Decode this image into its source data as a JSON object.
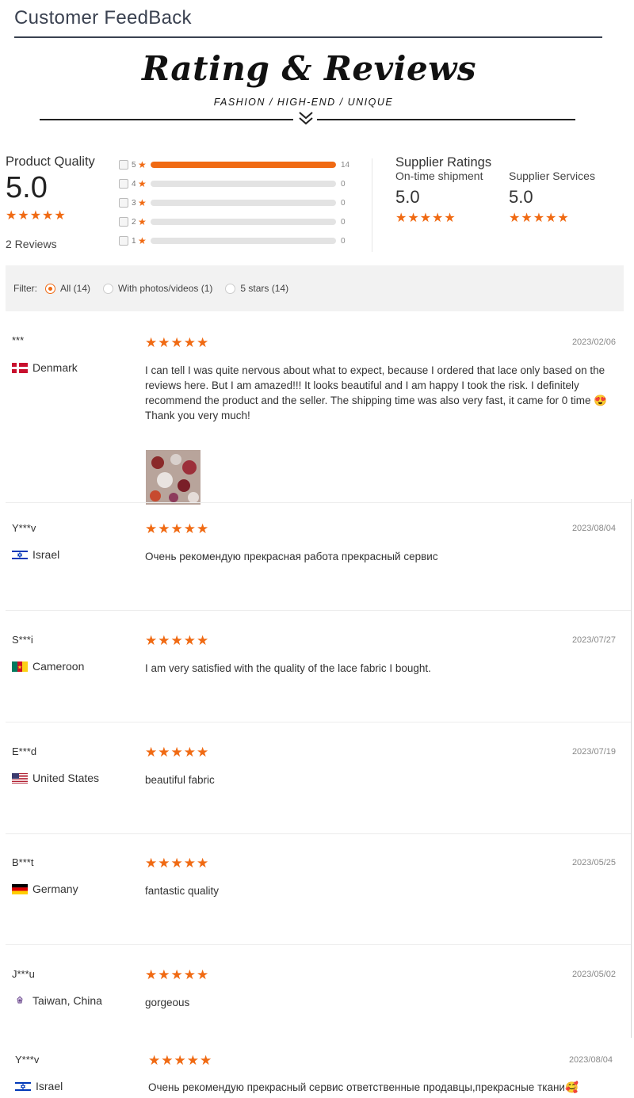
{
  "header": {
    "title": "Customer FeedBack"
  },
  "banner": {
    "title": "Rating & Reviews",
    "subtitle": "FASHION / HIGH-END / UNIQUE"
  },
  "product_quality": {
    "label": "Product Quality",
    "score": "5.0",
    "stars": 5,
    "reviews_label": "2 Reviews",
    "distribution": [
      {
        "stars": "5",
        "count": "14",
        "fraction": 1.0
      },
      {
        "stars": "4",
        "count": "0",
        "fraction": 0
      },
      {
        "stars": "3",
        "count": "0",
        "fraction": 0
      },
      {
        "stars": "2",
        "count": "0",
        "fraction": 0
      },
      {
        "stars": "1",
        "count": "0",
        "fraction": 0
      }
    ]
  },
  "supplier_ratings": {
    "title": "Supplier Ratings",
    "shipment": {
      "label": "On-time shipment",
      "score": "5.0",
      "stars": 5
    },
    "services": {
      "label": "Supplier Services",
      "score": "5.0",
      "stars": 5
    }
  },
  "filter": {
    "label": "Filter:",
    "options": [
      {
        "label": "All (14)",
        "selected": true
      },
      {
        "label": "With photos/videos (1)",
        "selected": false
      },
      {
        "label": "5 stars (14)",
        "selected": false
      }
    ]
  },
  "reviews": [
    {
      "user": "***",
      "country": "Denmark",
      "flag": "denmark-flag-icon",
      "date": "2023/02/06",
      "stars": 5,
      "text": "I can tell I was quite nervous about what to expect, because I ordered that lace only based on the reviews here. But I am amazed!!! It looks beautiful and I am happy I took the risk. I definitely recommend the product and the seller. The shipping time was also very fast, it came for 0 time 😍 Thank you very much!",
      "has_photo": true
    },
    {
      "user": "Y***v",
      "country": "Israel",
      "flag": "israel-flag-icon",
      "date": "2023/08/04",
      "stars": 5,
      "text": "Очень рекомендую прекрасная работа прекрасный сервис"
    },
    {
      "user": "S***i",
      "country": "Cameroon",
      "flag": "cameroon-flag-icon",
      "date": "2023/07/27",
      "stars": 5,
      "text": "I am very satisfied with the quality of the lace fabric I bought."
    },
    {
      "user": "E***d",
      "country": "United States",
      "flag": "usa-flag-icon",
      "date": "2023/07/19",
      "stars": 5,
      "text": "beautiful fabric"
    },
    {
      "user": "B***t",
      "country": "Germany",
      "flag": "germany-flag-icon",
      "date": "2023/05/25",
      "stars": 5,
      "text": "fantastic quality"
    },
    {
      "user": "J***u",
      "country": "Taiwan, China",
      "flag": "taiwan-flag-icon",
      "date": "2023/05/02",
      "stars": 5,
      "text": "gorgeous"
    },
    {
      "user": "Y***v",
      "country": "Israel",
      "flag": "israel-flag-icon",
      "date": "2023/08/04",
      "stars": 5,
      "text": "Очень рекомендую прекрасный сервис ответственные продавцы,прекрасные ткани🥰"
    }
  ],
  "colors": {
    "accent": "#f06a13",
    "bar_bg": "#e3e3e3",
    "filter_bg": "#f2f2f2"
  }
}
